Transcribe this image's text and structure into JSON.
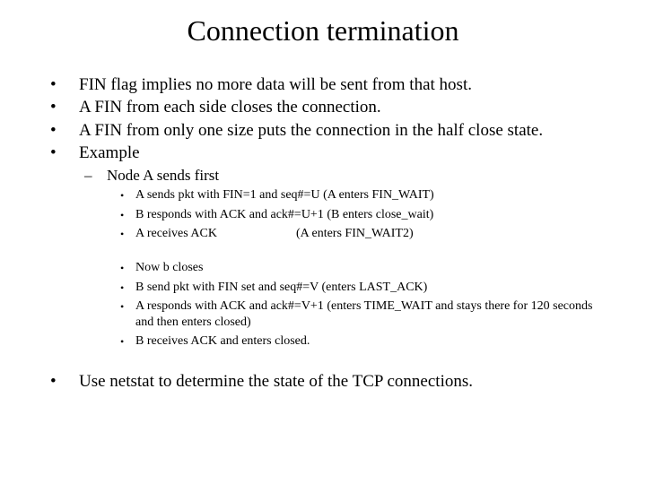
{
  "slide": {
    "title": "Connection termination",
    "bullet_glyph": "•",
    "dash_glyph": "–",
    "top_bullets": [
      "FIN flag implies no more data will be sent from that host.",
      "A FIN from each side closes the connection.",
      "A FIN from only one size puts the connection in the half close state.",
      "Example"
    ],
    "sub_heading": "Node A sends first",
    "group1": [
      "A sends pkt with FIN=1 and seq#=U (A enters FIN_WAIT)",
      "B responds with ACK and ack#=U+1 (B enters close_wait)"
    ],
    "group1_last": {
      "left": "A receives ACK",
      "right": "(A enters FIN_WAIT2)"
    },
    "group2": [
      "Now b closes",
      "B send pkt with FIN set and seq#=V (enters LAST_ACK)",
      "A responds with ACK and ack#=V+1 (enters TIME_WAIT and stays there for 120 seconds and then enters closed)",
      "B receives ACK and enters closed."
    ],
    "final_bullet": "Use netstat to determine the state of the TCP connections."
  }
}
